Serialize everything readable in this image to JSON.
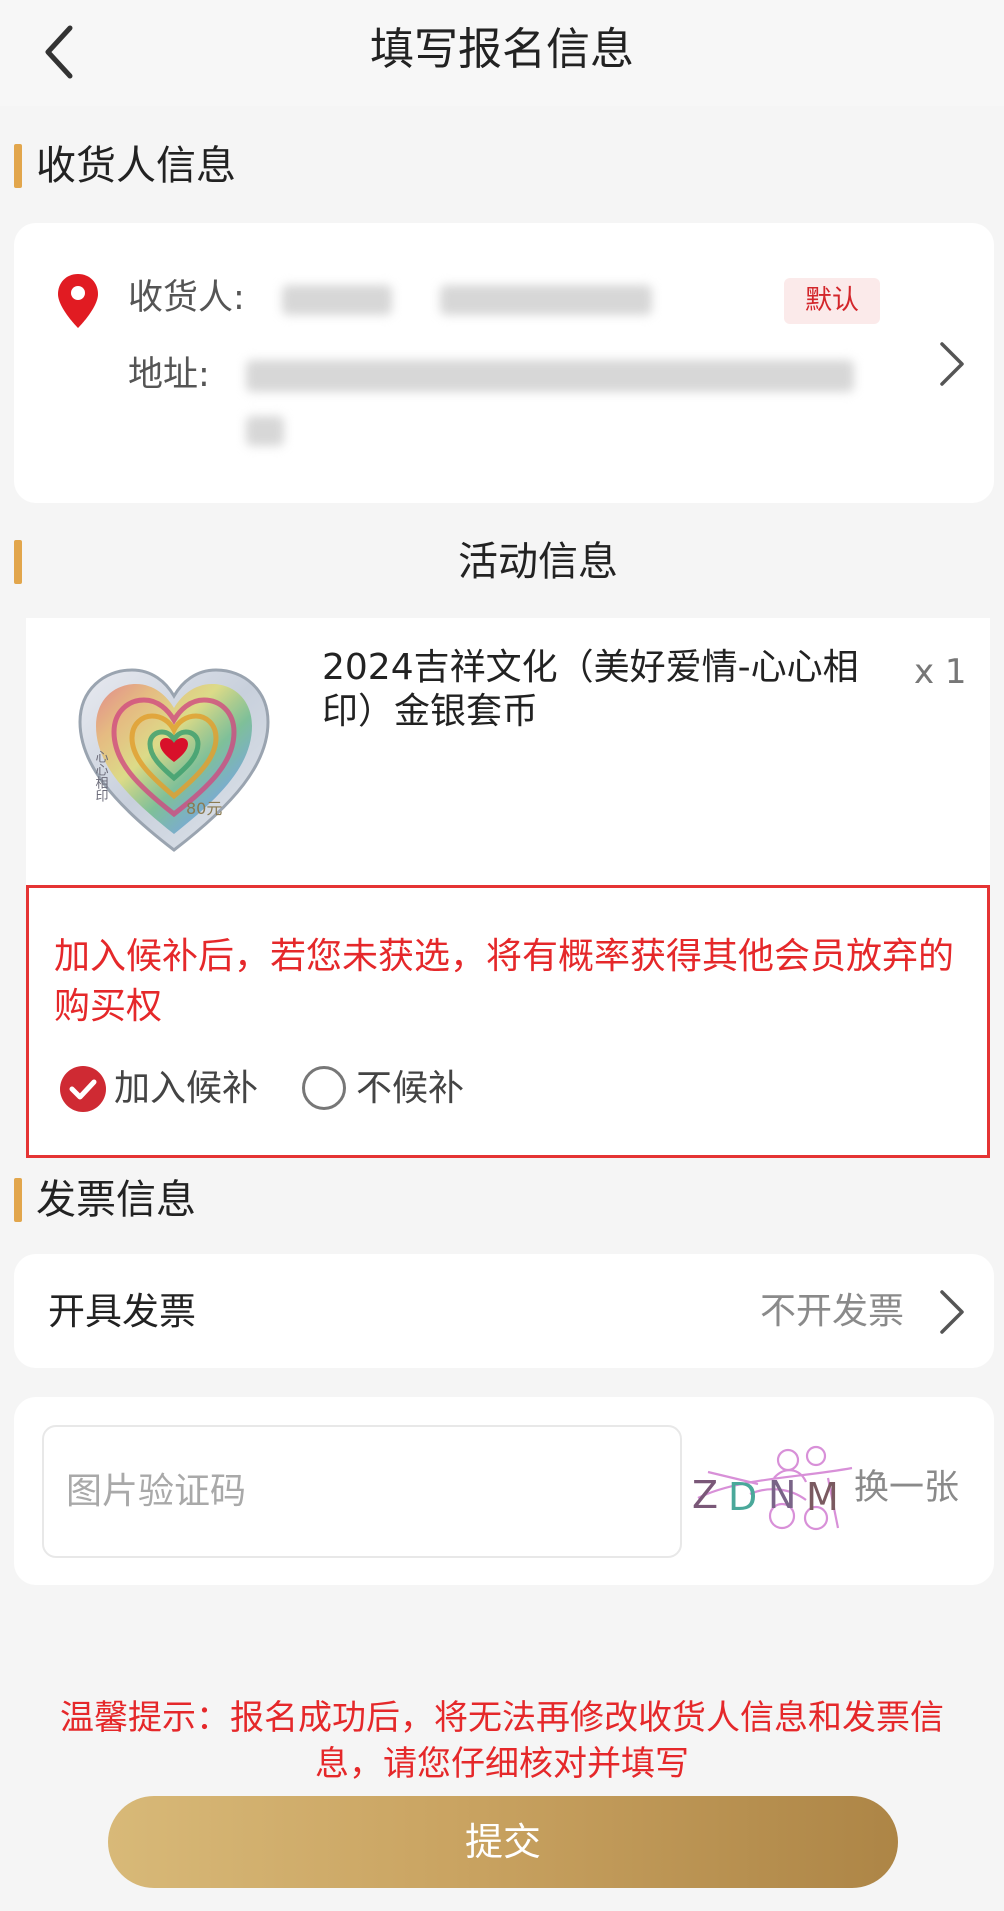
{
  "header": {
    "title": "填写报名信息"
  },
  "consignee_section": {
    "title": "收货人信息",
    "receiver_label": "收货人:",
    "address_label": "地址:",
    "default_badge": "默认"
  },
  "activity_section": {
    "title": "活动信息",
    "product_name": "2024吉祥文化（美好爱情-心心相印）金银套币",
    "quantity": "x 1",
    "coin_text": "心心相印",
    "coin_value": "80元"
  },
  "waitlist": {
    "notice": "加入候补后，若您未获选，将有概率获得其他会员放弃的购买权",
    "option_join": "加入候补",
    "option_no": "不候补",
    "selected": "加入候补"
  },
  "invoice_section": {
    "title": "发票信息",
    "row_label": "开具发票",
    "row_value": "不开发票"
  },
  "captcha": {
    "placeholder": "图片验证码",
    "code": "ZDNM",
    "refresh_label": "换一张"
  },
  "footer": {
    "tip": "温馨提示：报名成功后，将无法再修改收货人信息和发票信息，请您仔细核对并填写",
    "submit_label": "提交"
  },
  "colors": {
    "accent": "#e2a64c",
    "warning_red": "#e5282a",
    "button_gold": "#c9a361"
  }
}
